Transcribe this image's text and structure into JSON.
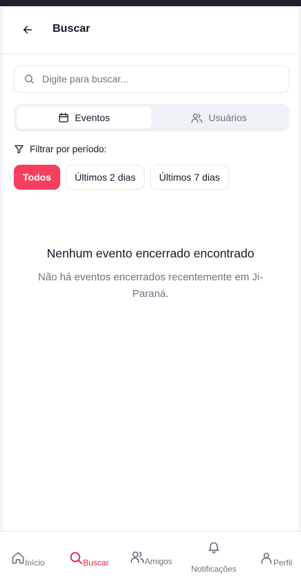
{
  "header": {
    "title": "Buscar"
  },
  "search": {
    "placeholder": "Digite para buscar...",
    "value": ""
  },
  "tabs": [
    {
      "label": "Eventos",
      "icon": "calendar-icon",
      "active": true
    },
    {
      "label": "Usuários",
      "icon": "users-icon",
      "active": false
    }
  ],
  "filter": {
    "label": "Filtrar por período:",
    "options": [
      {
        "label": "Todos",
        "active": true
      },
      {
        "label": "Últimos 2 dias",
        "active": false
      },
      {
        "label": "Últimos 7 dias",
        "active": false
      }
    ]
  },
  "empty_state": {
    "title": "Nenhum evento encerrado encontrado",
    "description": "Não há eventos encerrados recentemente em Ji-Paraná."
  },
  "bottom_nav": [
    {
      "label": "Início",
      "icon": "home-icon",
      "active": false
    },
    {
      "label": "Buscar",
      "icon": "search-icon",
      "active": true
    },
    {
      "label": "Amigos",
      "icon": "users-icon",
      "active": false
    },
    {
      "label": "Notificações",
      "icon": "bell-icon",
      "active": false
    },
    {
      "label": "Perfil",
      "icon": "user-icon",
      "active": false
    }
  ],
  "colors": {
    "accent": "#f43f5e",
    "accent_text": "#e11d48",
    "muted": "#6b7280",
    "border": "#e5e7eb"
  }
}
